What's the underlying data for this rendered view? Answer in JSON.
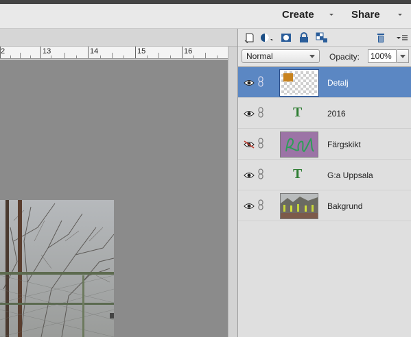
{
  "header": {
    "create_label": "Create",
    "share_label": "Share"
  },
  "ruler": {
    "labels": [
      "2",
      "13",
      "14",
      "15",
      "16"
    ]
  },
  "layers_panel": {
    "toolbar_icons": [
      "new-layer-icon",
      "adjustment-layer-icon",
      "layer-mask-icon",
      "lock-icon",
      "lock-transparency-icon",
      "trash-icon",
      "panel-menu-icon"
    ],
    "blend_mode": "Normal",
    "opacity_label": "Opacity:",
    "opacity_value": "100%",
    "layers": [
      {
        "name": "Detalj",
        "type": "image-transparent",
        "visible": true,
        "selected": true
      },
      {
        "name": "2016",
        "type": "text",
        "visible": true,
        "selected": false
      },
      {
        "name": "Färgskikt",
        "type": "fill",
        "visible": false,
        "selected": false
      },
      {
        "name": "G:a Uppsala",
        "type": "text",
        "visible": true,
        "selected": false
      },
      {
        "name": "Bakgrund",
        "type": "image",
        "visible": true,
        "selected": false
      }
    ],
    "text_thumb_glyph": "T"
  },
  "colors": {
    "selection": "#5b87c3",
    "canvas_bg": "#8b8b8b",
    "fill_layer": "#9c74a6"
  }
}
